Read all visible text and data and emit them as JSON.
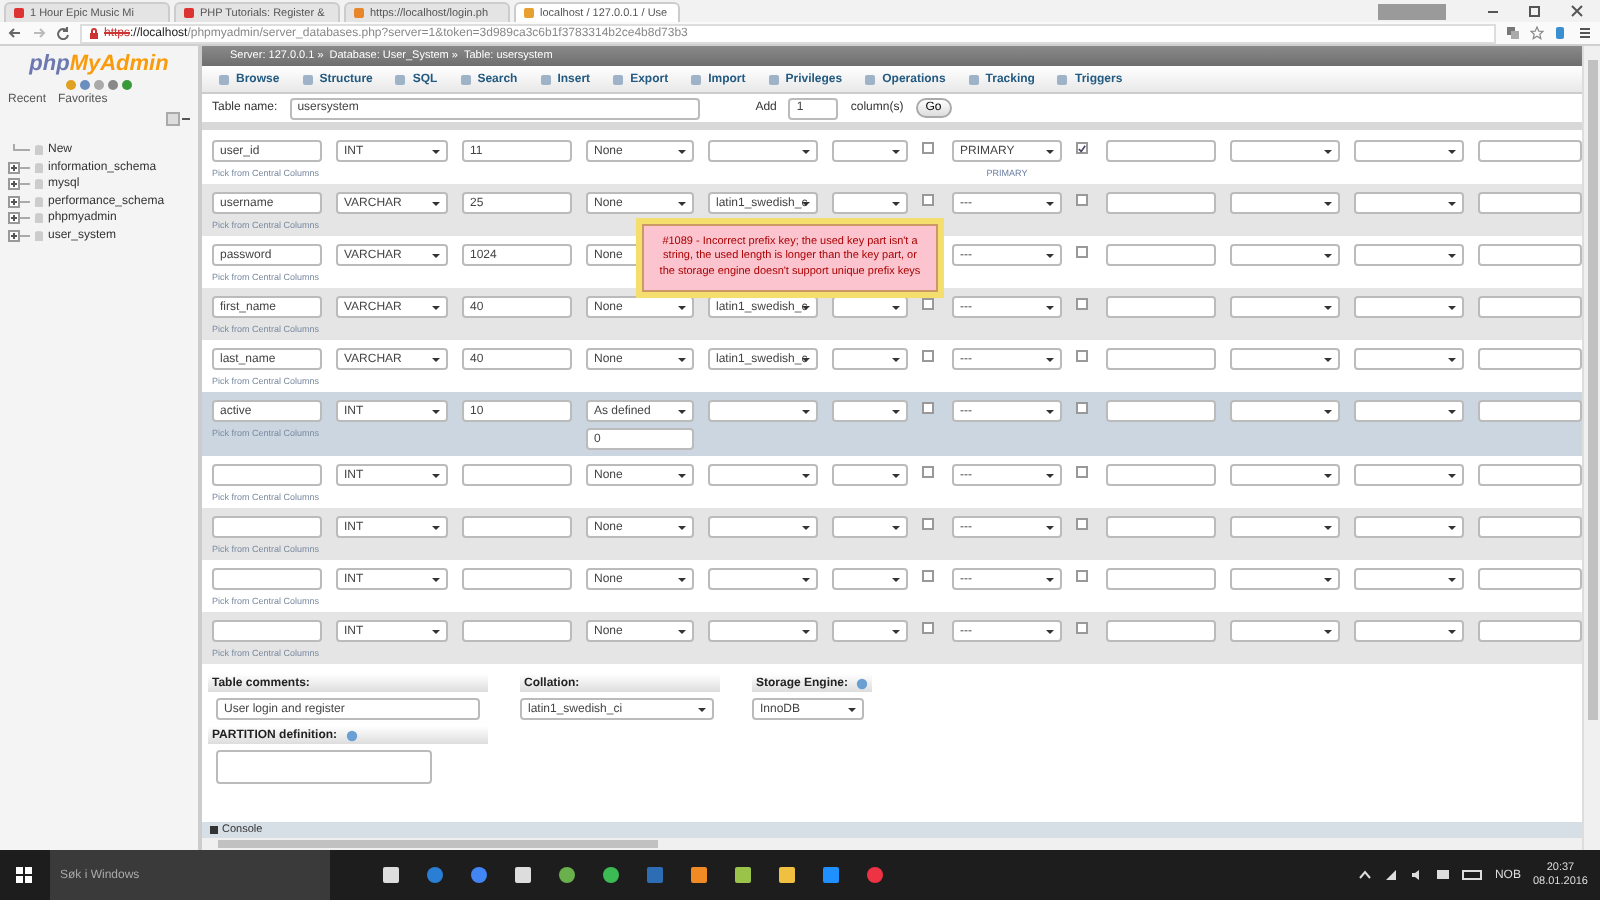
{
  "browser": {
    "tabs": [
      {
        "title": "1 Hour Epic Music Mi",
        "selected": false
      },
      {
        "title": "PHP Tutorials: Register &",
        "selected": false
      },
      {
        "title": "https://localhost/login.ph",
        "selected": false
      },
      {
        "title": "localhost / 127.0.0.1 / Use",
        "selected": true
      }
    ],
    "address": {
      "scheme": "https",
      "host": "://localhost",
      "path": "/phpmyadmin/server_databases.php?server=1&token=3d989ca3c6b1f3783314b2ce4b8d73b3"
    }
  },
  "sidebar": {
    "logo": {
      "prefix": "php",
      "name": "MyAdmin"
    },
    "links": [
      "Recent",
      "Favorites"
    ],
    "tree": [
      {
        "label": "New",
        "expandable": false
      },
      {
        "label": "information_schema",
        "expandable": true
      },
      {
        "label": "mysql",
        "expandable": true
      },
      {
        "label": "performance_schema",
        "expandable": true
      },
      {
        "label": "phpmyadmin",
        "expandable": true
      },
      {
        "label": "user_system",
        "expandable": true
      }
    ]
  },
  "breadcrumb": [
    "Server: 127.0.0.1 »",
    "Database: User_System »",
    "Table: usersystem"
  ],
  "menu": [
    "Browse",
    "Structure",
    "SQL",
    "Search",
    "Insert",
    "Export",
    "Import",
    "Privileges",
    "Operations",
    "Tracking",
    "Triggers"
  ],
  "table_name": {
    "label": "Table name:",
    "value": "usersystem",
    "add_label": "Add",
    "add_value": "1",
    "columns_label": "column(s)",
    "go": "Go"
  },
  "columns": [
    {
      "name": "user_id",
      "type": "INT",
      "length": "11",
      "default": "None",
      "null": false,
      "index": "PRIMARY",
      "index_note": "PRIMARY",
      "auto_increment": true,
      "pick": "Pick from Central Columns",
      "highlighted": false,
      "obscured": false
    },
    {
      "name": "username",
      "type": "VARCHAR",
      "length": "25",
      "default": "None",
      "collation": "latin1_swedish_c",
      "null": false,
      "index": "---",
      "auto_increment": false,
      "pick": "Pick from Central Columns",
      "highlighted": false,
      "obscured": false
    },
    {
      "name": "password",
      "type": "VARCHAR",
      "length": "1024",
      "default": "None",
      "index": "---",
      "auto_increment": false,
      "pick": "Pick from Central Columns",
      "highlighted": false,
      "obscured": true
    },
    {
      "name": "first_name",
      "type": "VARCHAR",
      "length": "40",
      "default": "None",
      "collation": "latin1_swedish_c",
      "null": false,
      "index": "---",
      "auto_increment": false,
      "pick": "Pick from Central Columns",
      "highlighted": false,
      "obscured": false
    },
    {
      "name": "last_name",
      "type": "VARCHAR",
      "length": "40",
      "default": "None",
      "collation": "latin1_swedish_c",
      "null": false,
      "index": "---",
      "auto_increment": false,
      "pick": "Pick from Central Columns",
      "highlighted": false,
      "obscured": false
    },
    {
      "name": "active",
      "type": "INT",
      "length": "10",
      "default": "As defined",
      "default_value": "0",
      "null": false,
      "index": "---",
      "auto_increment": false,
      "pick": "Pick from Central Columns",
      "highlighted": true,
      "obscured": false
    },
    {
      "type": "INT",
      "default": "None",
      "null": false,
      "index": "---",
      "auto_increment": false,
      "pick": "Pick from Central Columns",
      "highlighted": false,
      "obscured": false
    },
    {
      "type": "INT",
      "default": "None",
      "null": false,
      "index": "---",
      "auto_increment": false,
      "pick": "Pick from Central Columns",
      "highlighted": false,
      "obscured": false
    },
    {
      "type": "INT",
      "default": "None",
      "null": false,
      "index": "---",
      "auto_increment": false,
      "pick": "Pick from Central Columns",
      "highlighted": false,
      "obscured": false
    },
    {
      "type": "INT",
      "default": "None",
      "null": false,
      "index": "---",
      "auto_increment": false,
      "pick": "Pick from Central Columns",
      "highlighted": false,
      "obscured": false
    }
  ],
  "error": {
    "message": "#1089 - Incorrect prefix key; the used key part isn't a string, the used length is longer than the key part, or the storage engine doesn't support unique prefix keys"
  },
  "footer": {
    "comments_label": "Table comments:",
    "comments_value": "User login and register",
    "collation_label": "Collation:",
    "collation_value": "latin1_swedish_ci",
    "engine_label": "Storage Engine:",
    "engine_value": "InnoDB",
    "partition_label": "PARTITION definition:"
  },
  "console": "Console",
  "taskbar": {
    "search_placeholder": "Søk i Windows",
    "language": "NOB",
    "time": "20:37",
    "date": "08.01.2016"
  }
}
